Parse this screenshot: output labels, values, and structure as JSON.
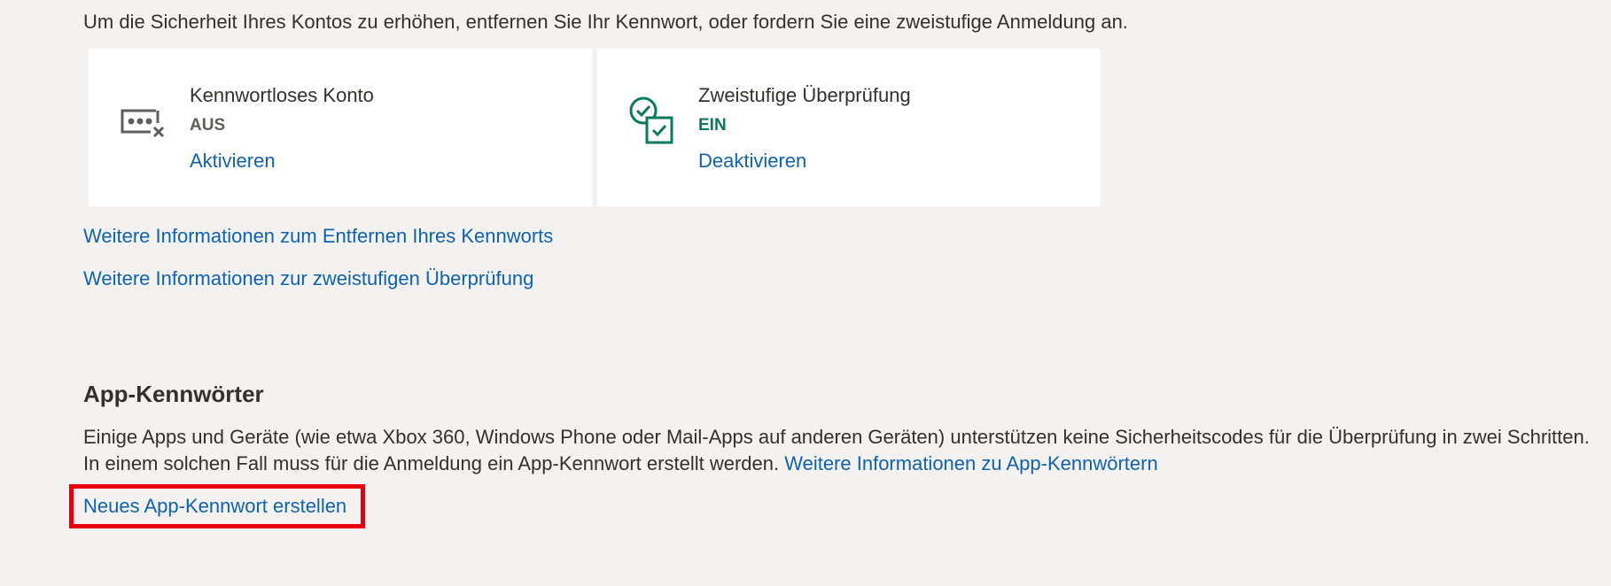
{
  "intro_text": "Um die Sicherheit Ihres Kontos zu erhöhen, entfernen Sie Ihr Kennwort, oder fordern Sie eine zweistufige Anmeldung an.",
  "cards": {
    "passwordless": {
      "icon": "password-dots-cross-icon",
      "title": "Kennwortloses Konto",
      "status": "AUS",
      "status_color": "#605e5c",
      "action": "Aktivieren"
    },
    "two_step": {
      "icon": "double-check-icon",
      "title": "Zweistufige Überprüfung",
      "status": "EIN",
      "status_color": "#0b7a5c",
      "action": "Deaktivieren"
    }
  },
  "links": {
    "remove_password_info": "Weitere Informationen zum Entfernen Ihres Kennworts",
    "two_step_info": "Weitere Informationen zur zweistufigen Überprüfung"
  },
  "app_passwords": {
    "heading": "App-Kennwörter",
    "description": "Einige Apps und Geräte (wie etwa Xbox 360, Windows Phone oder Mail-Apps auf anderen Geräten) unterstützen keine Sicherheitscodes für die Überprüfung in zwei Schritten. In einem solchen Fall muss für die Anmeldung ein App-Kennwort erstellt werden.",
    "info_link": "Weitere Informationen zu App-Kennwörtern",
    "create_link": "Neues App-Kennwort erstellen"
  },
  "colors": {
    "link": "#0f62b0",
    "highlight_border": "#e8000d",
    "teal_accent": "#0b7a5c",
    "background": "#f3f2f1"
  }
}
